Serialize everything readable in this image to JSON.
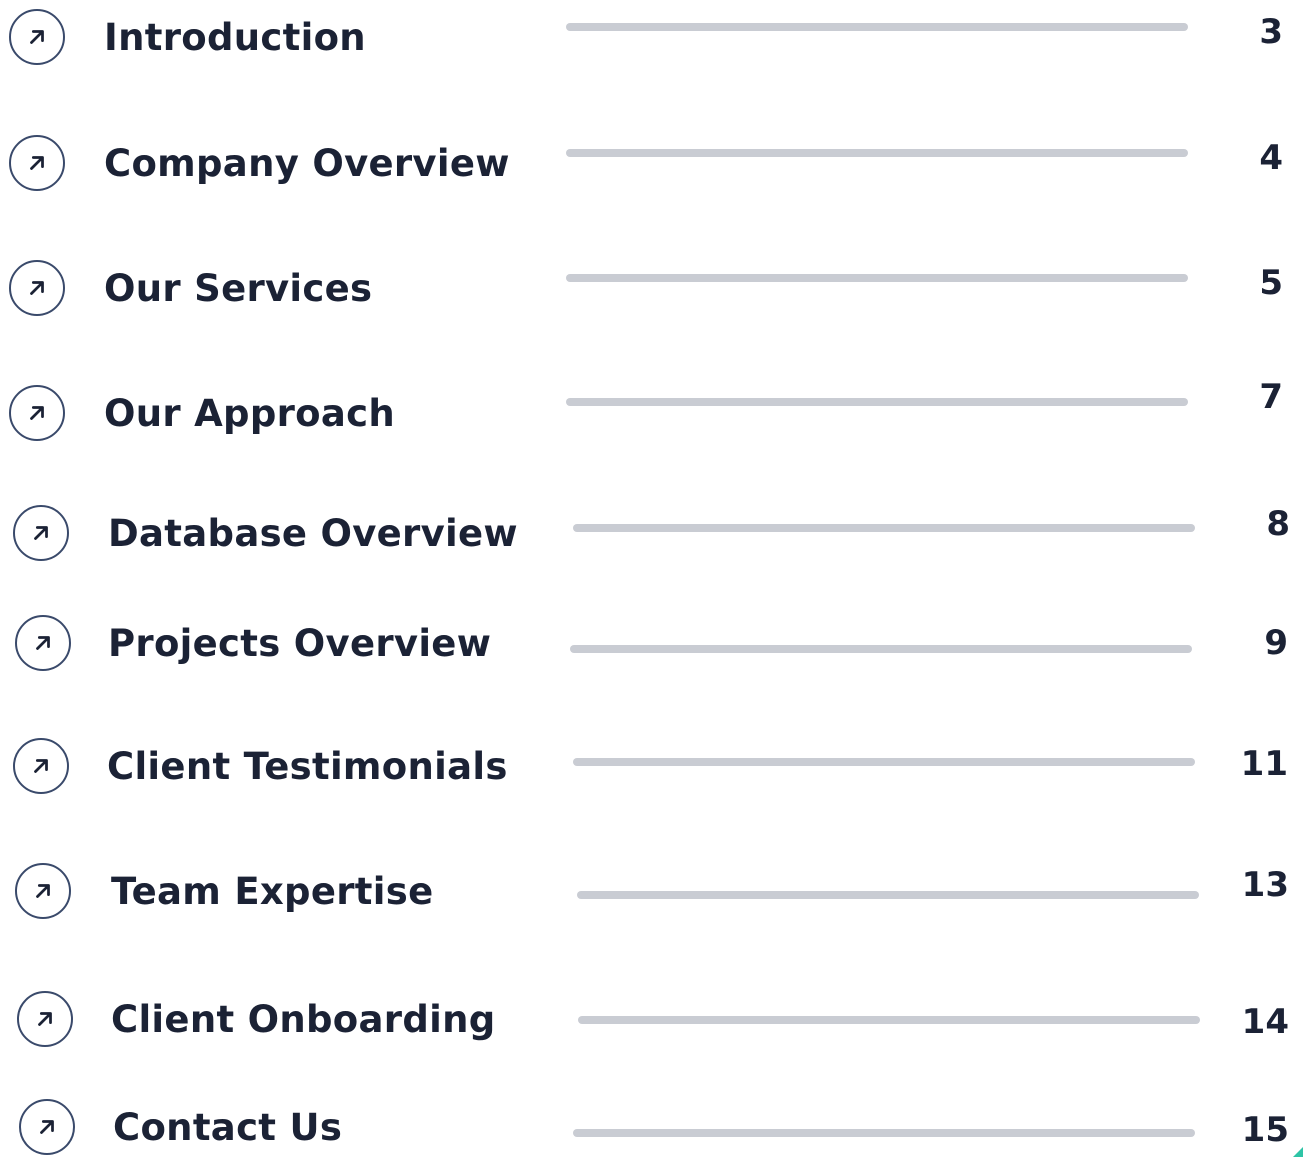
{
  "toc": {
    "entries": [
      {
        "label": "Introduction",
        "page": "3"
      },
      {
        "label": "Company Overview",
        "page": "4"
      },
      {
        "label": "Our Services",
        "page": "5"
      },
      {
        "label": "Our Approach",
        "page": "7"
      },
      {
        "label": "Database Overview",
        "page": "8"
      },
      {
        "label": "Projects Overview",
        "page": "9"
      },
      {
        "label": "Client Testimonials",
        "page": "11"
      },
      {
        "label": "Team Expertise",
        "page": "13"
      },
      {
        "label": "Client Onboarding",
        "page": "14"
      },
      {
        "label": "Contact Us",
        "page": "15"
      }
    ],
    "icon": "arrow-up-right-icon"
  },
  "colors": {
    "text": "#1b2235",
    "icon_border": "#3a4a6b",
    "leader": "#c9ccd3",
    "accent": "#2ec4a6"
  }
}
